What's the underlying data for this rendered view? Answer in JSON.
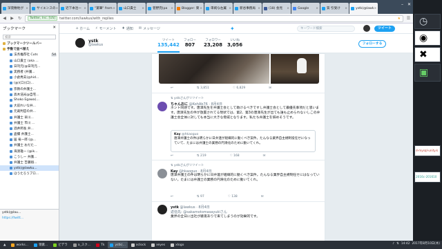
{
  "colors": {
    "twitter_blue": "#1da1f2",
    "link": "#1b95e0",
    "text_secondary": "#657786",
    "timeline_bg": "#e6ecf0"
  },
  "tabs": [
    {
      "label": "深夜敷地が",
      "color": "#1da1f2",
      "active": false
    },
    {
      "label": "サイエンスの",
      "color": "#1da1f2",
      "active": false
    },
    {
      "label": "近下本治ー",
      "color": "#1da1f2",
      "active": false
    },
    {
      "label": "\"葉筆\" from",
      "color": "#1da1f2",
      "active": false
    },
    {
      "label": "山口貴士",
      "color": "#1da1f2",
      "active": false
    },
    {
      "label": "菅野完(pa",
      "color": "#1da1f2",
      "active": false
    },
    {
      "label": "Blogger: 東",
      "color": "#f57d00",
      "active": false
    },
    {
      "label": "単純な左翼",
      "color": "#1da1f2",
      "active": false
    },
    {
      "label": "新谷事務局",
      "color": "#1da1f2",
      "active": false
    },
    {
      "label": "(18) 会見",
      "color": "#3b5998",
      "active": false
    },
    {
      "label": "Google",
      "color": "#4285f4",
      "active": false
    },
    {
      "label": "質 引受け",
      "color": "#1da1f2",
      "active": false
    },
    {
      "label": "ystk(@lawk",
      "color": "#1da1f2",
      "active": true
    }
  ],
  "address": {
    "site_badge": "Twitter, Inc. [US]",
    "url": "twitter.com/lawkus/with_replies"
  },
  "sidebar": {
    "title": "ブックマーク",
    "search_placeholder": "検索",
    "rows": [
      {
        "label": "ブックマークツールバー",
        "type": "group"
      },
      {
        "label": "手動で並べ替え",
        "type": "group"
      },
      {
        "label": "法务推荐社 Cuts",
        "type": "indent",
        "count": "54"
      },
      {
        "label": "山口貴士 (aka ...",
        "type": "indent"
      },
      {
        "label": "日刊元(@日刊元...",
        "type": "indent"
      },
      {
        "label": "実務者 (弁護...",
        "type": "indent"
      },
      {
        "label": "小倉秀夫(@hid...",
        "type": "indent"
      },
      {
        "label": "(@)(口)(口)...",
        "type": "indent"
      },
      {
        "label": "宗教の弁護士...",
        "type": "indent"
      },
      {
        "label": "高木浩光@自宅...",
        "type": "indent"
      },
      {
        "label": "Shoko Egawa(...",
        "type": "indent"
      },
      {
        "label": "大前れいな弁...",
        "type": "indent"
      },
      {
        "label": "元裁判官の弁...",
        "type": "indent"
      },
      {
        "label": "弁護士 早川...",
        "type": "indent"
      },
      {
        "label": "弁護士 市川 ...",
        "type": "indent"
      },
      {
        "label": "酒井所長 弁...",
        "type": "indent"
      },
      {
        "label": "盗撮 弁護士...",
        "type": "indent"
      },
      {
        "label": "居 竜一郎 (@...",
        "type": "indent"
      },
      {
        "label": "弁護士 おだた...",
        "type": "indent"
      },
      {
        "label": "海渡雄一 (@ik...",
        "type": "indent"
      },
      {
        "label": "こうしー 弁護...",
        "type": "indent"
      },
      {
        "label": "弁護士 吉藤翔...",
        "type": "indent"
      },
      {
        "label": "ystk(@lawku...",
        "type": "indent",
        "selected": true
      },
      {
        "label": "ほうたろうブロ...",
        "type": "indent"
      }
    ],
    "panel_title": "ystk(@lau...",
    "panel_link": "https://twitt..."
  },
  "twitter_nav": {
    "home": "ホーム",
    "moments": "モーメント",
    "notifications": "通知",
    "messages": "メッセージ",
    "search_placeholder": "キーワード検索",
    "tweet_button": "ツイート"
  },
  "profile": {
    "name": "ystk",
    "handle": "@lawkus",
    "stats": [
      {
        "label": "ツイート",
        "value": "135,442",
        "active": true
      },
      {
        "label": "フォロー",
        "value": "807",
        "active": false
      },
      {
        "label": "フォロワー",
        "value": "23,208",
        "active": false
      },
      {
        "label": "いいね",
        "value": "3,056",
        "active": false
      }
    ],
    "follow_button": "フォローする"
  },
  "media_tweet_actions": {
    "retweets": "3,851",
    "likes": "6,829"
  },
  "tweets": [
    {
      "retweet_by": "ystkさんがリツイート",
      "name": "ちゃんおに",
      "handle": "@KohAb76",
      "date": "8月4日",
      "body": "ホント同感です。唐澤先生を弁護士会として助けるべきですし弁護士会として最優先事項だと思います。唐澤先生の件が放置されてる現状では、第2、第3の唐澤先生が出ても誰も止められないしこの弁護士会全体に対しても本当に大きな脅威となります。私たち弁護士を辞めそうです。",
      "quote_name": "Kay",
      "quote_handle": "@hkaoguo",
      "quote_body": "唐澤弁護士の件は明らかに日弁連が組織的に動くべき案件。たんなる業界自主規制役任せになっていて、たまには弁護士の業務の円滑化のために動いてくれ。",
      "retweets": "219",
      "likes": "168"
    },
    {
      "retweet_by": "ystkさんがリツイート",
      "name": "Kay",
      "handle": "@hkaoguo",
      "date": "8月4日",
      "body": "唐澤弁護士の件は明らかに日弁連が組織的に動くべき案件。たんなる業界自主規制任せにはなっていない。たまには弁護士の業務の円滑化のために動いてくれ。",
      "retweets": "97",
      "likes": "138"
    },
    {
      "name": "ystk",
      "handle": "@lawkus",
      "date": "8月4日",
      "reply_to_label": "返信先:",
      "reply_to": "@sakamotomasayukiさん",
      "body": "業界の全日に出社が徹夜ありで来てしまうのが効果的です。"
    }
  ],
  "dock": {
    "top_label": "d-mysql-unity.k",
    "mid_label": "2016c-201610"
  },
  "taskbar": {
    "items": [
      "works...",
      "領素...",
      "ビデラ",
      "a_スク...",
      "Tk",
      "ystk(...",
      "xclock",
      "xeyes",
      "xlogo"
    ],
    "time": "14:42",
    "date": "2017年8月10日(木)"
  }
}
